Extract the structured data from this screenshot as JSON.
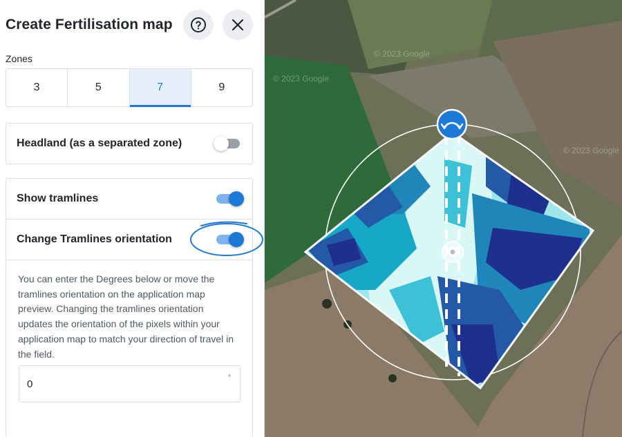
{
  "panel": {
    "title": "Create Fertilisation map",
    "zones_label": "Zones",
    "zones": [
      "3",
      "5",
      "7",
      "9"
    ],
    "selected_zone": "7",
    "headland": {
      "label": "Headland (as a separated zone)",
      "enabled": false
    },
    "tramlines": {
      "label": "Show tramlines",
      "enabled": true
    },
    "orientation": {
      "label": "Change Tramlines orientation",
      "enabled": true,
      "description": "You can enter the Degrees below or move the tramlines orientation on the application map preview. Changing the tramlines orientation updates the orientation of the pixels within your application map to match your direction of travel in the field.",
      "degrees_value": "0",
      "degrees_unit": "°"
    }
  },
  "map": {
    "watermark_1": "© 2023 Google",
    "watermark_2": "© 2023 Google",
    "watermark_3": "© 2023 Google"
  },
  "colors": {
    "accent": "#1c7ad6",
    "accent_light": "#e5f0fb",
    "zone_palette": [
      "#1f2f8e",
      "#2459a8",
      "#1e86b8",
      "#17a7c7",
      "#3dc1d6",
      "#9fe6ea",
      "#d9f7f5"
    ]
  },
  "icons": {
    "help": "help-circle-icon",
    "close": "close-icon",
    "rotate": "rotate-arrows-icon",
    "center": "center-handle-icon"
  }
}
